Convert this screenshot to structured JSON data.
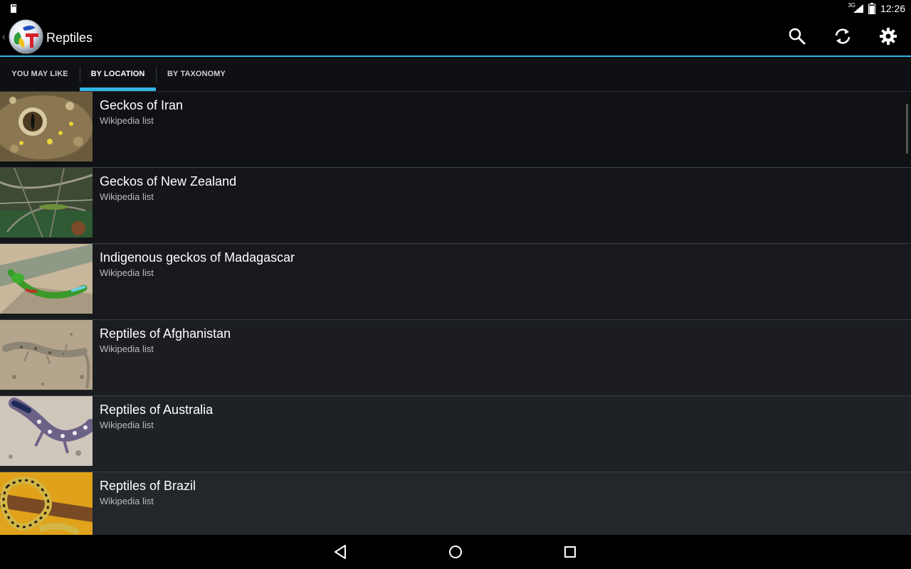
{
  "status_bar": {
    "network": "3G",
    "time": "12:26",
    "icons": [
      "sd-card-icon",
      "signal-icon",
      "battery-icon"
    ]
  },
  "action_bar": {
    "title": "Reptiles",
    "icons": [
      "search-icon",
      "refresh-icon",
      "settings-icon"
    ]
  },
  "tabs": [
    {
      "label": "YOU MAY LIKE",
      "active": false
    },
    {
      "label": "BY LOCATION",
      "active": true
    },
    {
      "label": "BY TAXONOMY",
      "active": false
    }
  ],
  "list": {
    "items": [
      {
        "title": "Geckos of Iran",
        "subtitle": "Wikipedia list"
      },
      {
        "title": "Geckos of New Zealand",
        "subtitle": "Wikipedia list"
      },
      {
        "title": "Indigenous geckos of Madagascar",
        "subtitle": "Wikipedia list"
      },
      {
        "title": "Reptiles of Afghanistan",
        "subtitle": "Wikipedia list"
      },
      {
        "title": "Reptiles of Australia",
        "subtitle": "Wikipedia list"
      },
      {
        "title": "Reptiles of Brazil",
        "subtitle": "Wikipedia list"
      }
    ]
  },
  "nav_bar": {
    "icons": [
      "back-icon",
      "home-icon",
      "recents-icon"
    ]
  },
  "colors": {
    "accent": "#33b5e5",
    "background": "#000000"
  }
}
